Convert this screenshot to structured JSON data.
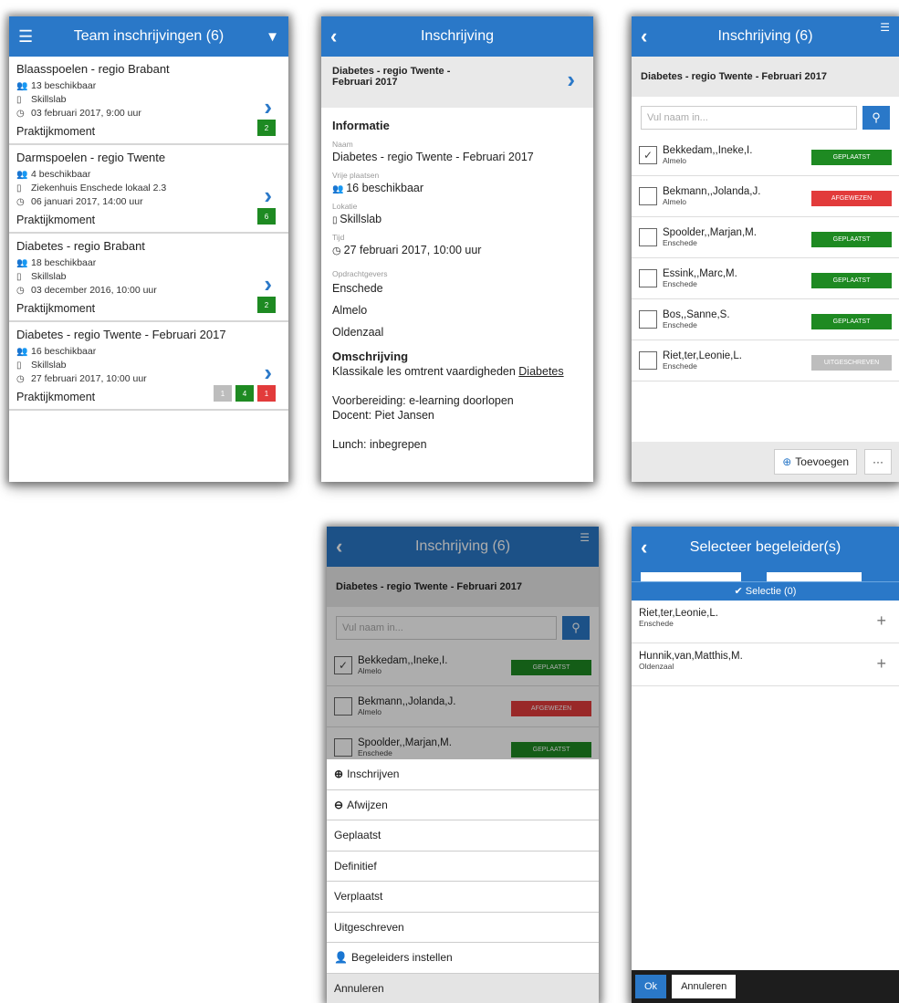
{
  "screen1": {
    "title": "Team inschrijvingen (6)",
    "items": [
      {
        "title": "Blaasspoelen - regio Brabant",
        "available": "13 beschikbaar",
        "location": "Skillslab",
        "time": "03 februari 2017, 9:00 uur",
        "type": "Praktijkmoment",
        "badges": [
          {
            "text": "2",
            "color": "g"
          }
        ]
      },
      {
        "title": "Darmspoelen - regio Twente",
        "available": "4 beschikbaar",
        "location": "Ziekenhuis Enschede lokaal 2.3",
        "time": "06 januari 2017, 14:00 uur",
        "type": "Praktijkmoment",
        "badges": [
          {
            "text": "6",
            "color": "g"
          }
        ]
      },
      {
        "title": "Diabetes - regio Brabant",
        "available": "18 beschikbaar",
        "location": "Skillslab",
        "time": "03 december 2016, 10:00 uur",
        "type": "Praktijkmoment",
        "badges": [
          {
            "text": "2",
            "color": "g"
          }
        ]
      },
      {
        "title": "Diabetes - regio Twente - Februari 2017",
        "available": "16 beschikbaar",
        "location": "Skillslab",
        "time": "27 februari 2017, 10:00 uur",
        "type": "Praktijkmoment",
        "badges": [
          {
            "text": "1",
            "color": "gr"
          },
          {
            "text": "4",
            "color": "g"
          },
          {
            "text": "1",
            "color": "r"
          }
        ]
      }
    ]
  },
  "screen2": {
    "title": "Inschrijving",
    "subhead_line1": "Diabetes - regio Twente -",
    "subhead_line2": "Februari 2017",
    "section_info": "Informatie",
    "label_name": "Naam",
    "name": "Diabetes - regio Twente - Februari 2017",
    "label_free": "Vrije plaatsen",
    "free": "16 beschikbaar",
    "label_location": "Lokatie",
    "location": "Skillslab",
    "label_time": "Tijd",
    "time": "27 februari 2017, 10:00 uur",
    "label_clients": "Opdrachtgevers",
    "clients": [
      "Enschede",
      "Almelo",
      "Oldenzaal"
    ],
    "section_desc": "Omschrijving",
    "desc_prefix": "Klassikale les omtrent vaardigheden ",
    "desc_link": "Diabetes",
    "prep": "Voorbereiding: e-learning doorlopen",
    "teacher": "Docent: Piet Jansen",
    "lunch": "Lunch: inbegrepen"
  },
  "screen3": {
    "title": "Inschrijving (6)",
    "subhead": "Diabetes - regio Twente - Februari 2017",
    "search_placeholder": "Vul naam in...",
    "rows": [
      {
        "name": "Bekkedam,,Ineke,I.",
        "city": "Almelo",
        "status": "GEPLAATST",
        "color": "g",
        "checked": "✓"
      },
      {
        "name": "Bekmann,,Jolanda,J.",
        "city": "Almelo",
        "status": "AFGEWEZEN",
        "color": "r",
        "checked": ""
      },
      {
        "name": "Spoolder,,Marjan,M.",
        "city": "Enschede",
        "status": "GEPLAATST",
        "color": "g",
        "checked": ""
      },
      {
        "name": "Essink,,Marc,M.",
        "city": "Enschede",
        "status": "GEPLAATST",
        "color": "g",
        "checked": ""
      },
      {
        "name": "Bos,,Sanne,S.",
        "city": "Enschede",
        "status": "GEPLAATST",
        "color": "g",
        "checked": ""
      },
      {
        "name": "Riet,ter,Leonie,L.",
        "city": "Enschede",
        "status": "UITGESCHREVEN",
        "color": "gr",
        "checked": ""
      }
    ],
    "add_label": "Toevoegen",
    "more_label": "···"
  },
  "screen4": {
    "actions": [
      "Inschrijven",
      "Afwijzen",
      "Geplaatst",
      "Definitief",
      "Verplaatst",
      "Uitgeschreven",
      "Begeleiders instellen",
      "Annuleren"
    ]
  },
  "screen5": {
    "title": "Selecteer begeleider(s)",
    "selection": "✔ Selectie (0)",
    "rows": [
      {
        "name": "Riet,ter,Leonie,L.",
        "city": "Enschede"
      },
      {
        "name": "Hunnik,van,Matthis,M.",
        "city": "Oldenzaal"
      }
    ],
    "ok": "Ok",
    "cancel": "Annuleren"
  }
}
